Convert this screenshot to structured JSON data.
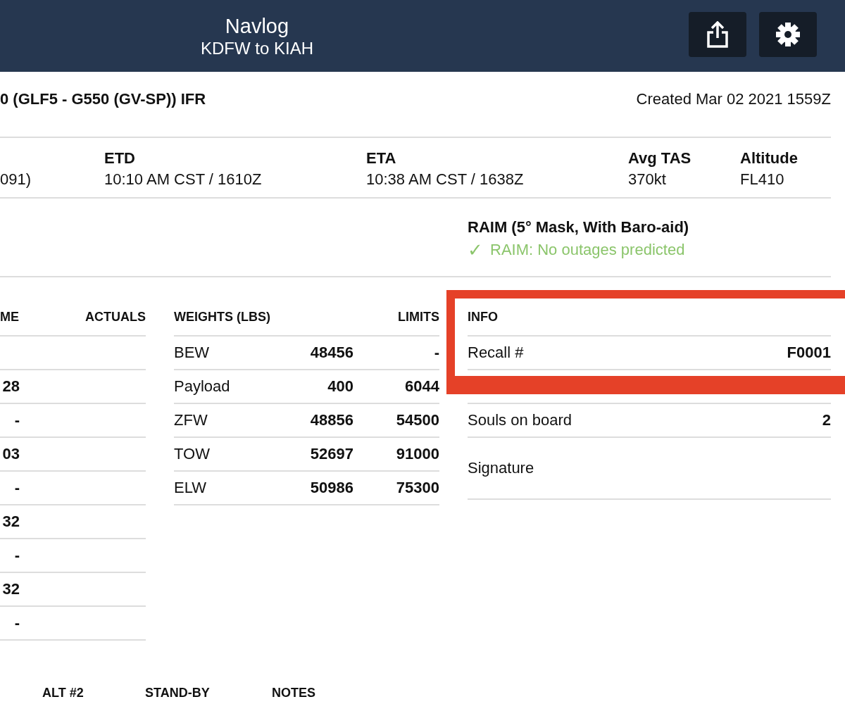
{
  "header": {
    "title": "Navlog",
    "subtitle": "KDFW to KIAH"
  },
  "summary": {
    "aircraft": "0 (GLF5 - G550 (GV-SP)) IFR",
    "created": "Created Mar 02 2021 1559Z"
  },
  "flight_info": [
    {
      "value": "091)"
    },
    {
      "label": "ETD",
      "value": "10:10 AM CST / 1610Z"
    },
    {
      "label": "ETA",
      "value": "10:38 AM CST / 1638Z"
    },
    {
      "label": "Avg TAS",
      "value": "370kt"
    },
    {
      "label": "Altitude",
      "value": "FL410"
    }
  ],
  "raim": {
    "title": "RAIM (5° Mask, With Baro-aid)",
    "check": "✓",
    "status": "RAIM: No outages predicted"
  },
  "times_table": {
    "columns": [
      "ME",
      "ACTUALS"
    ],
    "rows": [
      null,
      "28",
      "-",
      "03",
      "-",
      "32",
      "-",
      "32",
      "-"
    ]
  },
  "weights_table": {
    "columns": [
      "WEIGHTS (LBS)",
      "LIMITS"
    ],
    "rows": [
      {
        "label": "BEW",
        "weight": "48456",
        "limit": "-"
      },
      {
        "label": "Payload",
        "weight": "400",
        "limit": "6044"
      },
      {
        "label": "ZFW",
        "weight": "48856",
        "limit": "54500"
      },
      {
        "label": "TOW",
        "weight": "52697",
        "limit": "91000"
      },
      {
        "label": "ELW",
        "weight": "50986",
        "limit": "75300"
      }
    ]
  },
  "info_table": {
    "title": "INFO",
    "highlighted": true,
    "recall": {
      "label": "Recall #",
      "value": "F0001"
    },
    "rows": [
      {
        "label": "Souls on board",
        "value": "2"
      },
      {
        "label": "Signature"
      }
    ]
  },
  "bottom_columns": [
    "ALT #2",
    "STAND-BY",
    "NOTES"
  ]
}
